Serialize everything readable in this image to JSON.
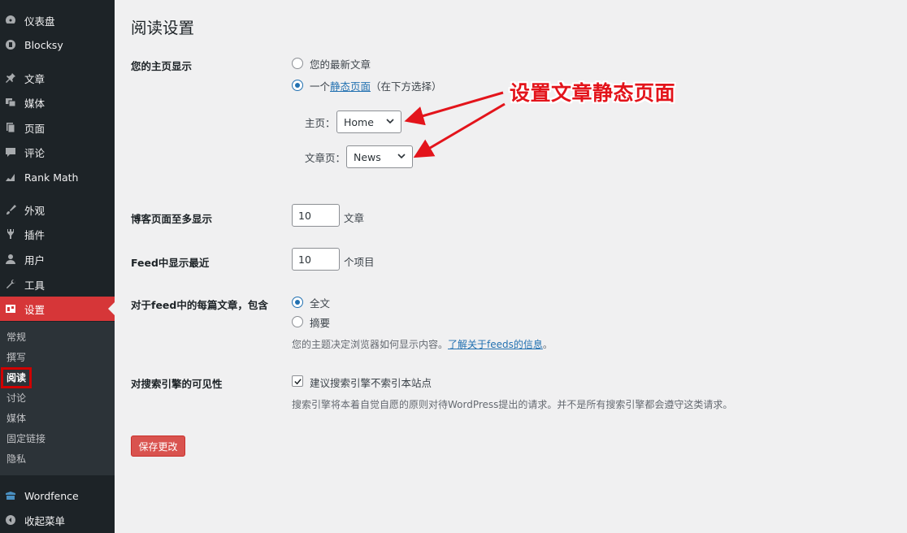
{
  "sidebar": {
    "items": [
      {
        "label": "仪表盘",
        "icon": "dashboard-icon"
      },
      {
        "label": "Blocksy",
        "icon": "blocksy-icon"
      },
      {
        "label": "文章",
        "icon": "pin-icon"
      },
      {
        "label": "媒体",
        "icon": "media-icon"
      },
      {
        "label": "页面",
        "icon": "page-icon"
      },
      {
        "label": "评论",
        "icon": "comment-icon"
      },
      {
        "label": "Rank Math",
        "icon": "rank-math-icon"
      },
      {
        "label": "外观",
        "icon": "brush-icon"
      },
      {
        "label": "插件",
        "icon": "plugin-icon"
      },
      {
        "label": "用户",
        "icon": "user-icon"
      },
      {
        "label": "工具",
        "icon": "wrench-icon"
      },
      {
        "label": "设置",
        "icon": "settings-icon"
      },
      {
        "label": "Wordfence",
        "icon": "wordfence-icon"
      },
      {
        "label": "收起菜单",
        "icon": "collapse-icon"
      }
    ],
    "submenu": [
      "常规",
      "撰写",
      "阅读",
      "讨论",
      "媒体",
      "固定链接",
      "隐私"
    ]
  },
  "page": {
    "title": "阅读设置",
    "homepage_display": {
      "label": "您的主页显示",
      "option_latest": "您的最新文章",
      "option_static_prefix": "一个",
      "option_static_link": "静态页面",
      "option_static_suffix": "（在下方选择）",
      "homepage_label": "主页：",
      "homepage_value": "Home",
      "postspage_label": "文章页：",
      "postspage_value": "News"
    },
    "blog_pages": {
      "label": "博客页面至多显示",
      "value": "10",
      "unit": "文章"
    },
    "feed_items": {
      "label": "Feed中显示最近",
      "value": "10",
      "unit": "个项目"
    },
    "feed_content": {
      "label": "对于feed中的每篇文章，包含",
      "option_full": "全文",
      "option_summary": "摘要",
      "desc_prefix": "您的主题决定浏览器如何显示内容。",
      "desc_link": "了解关于feeds的信息",
      "desc_suffix": "。"
    },
    "search_visibility": {
      "label": "对搜索引擎的可见性",
      "checkbox_label": "建议搜索引擎不索引本站点",
      "desc": "搜索引擎将本着自觉自愿的原则对待WordPress提出的请求。并不是所有搜索引擎都会遵守这类请求。"
    },
    "save_button": "保存更改"
  },
  "annotation": {
    "text": "设置文章静态页面",
    "color": "#e3141b"
  },
  "colors": {
    "sidebar_bg": "#1d2327",
    "active": "#d63638",
    "link": "#2271b1",
    "button": "#d9534f"
  }
}
